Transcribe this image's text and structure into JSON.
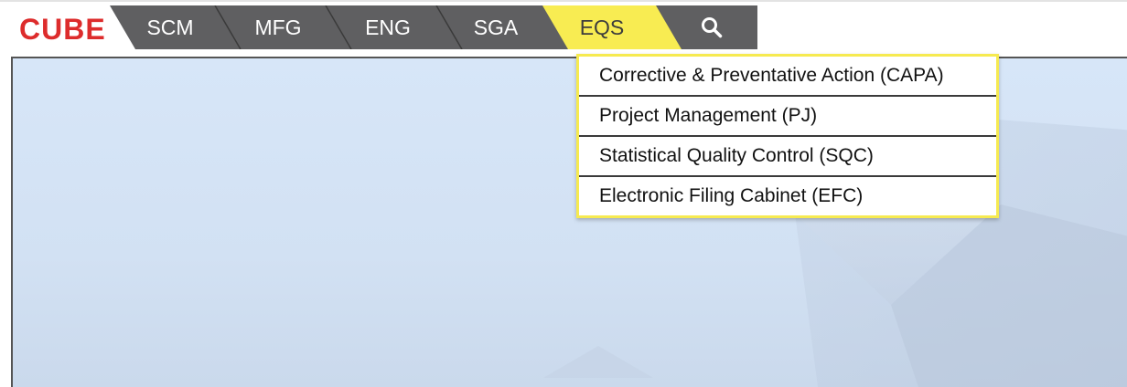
{
  "logo": {
    "text": "CUBE",
    "color": "#dd2c2c"
  },
  "nav": {
    "tabs": [
      {
        "label": "SCM",
        "active": false
      },
      {
        "label": "MFG",
        "active": false
      },
      {
        "label": "ENG",
        "active": false
      },
      {
        "label": "SGA",
        "active": false
      },
      {
        "label": "EQS",
        "active": true
      }
    ],
    "search_icon": "search-icon",
    "colors": {
      "tab_bg": "#5f5f61",
      "active_bg": "#f8ec52",
      "separator": "#3a3a3a"
    }
  },
  "dropdown": {
    "items": [
      {
        "label": "Corrective & Preventative Action (CAPA)"
      },
      {
        "label": "Project Management (PJ)"
      },
      {
        "label": "Statistical Quality Control (SQC)"
      },
      {
        "label": "Electronic Filing Cabinet (EFC)"
      }
    ],
    "border_color": "#f6ea50"
  }
}
